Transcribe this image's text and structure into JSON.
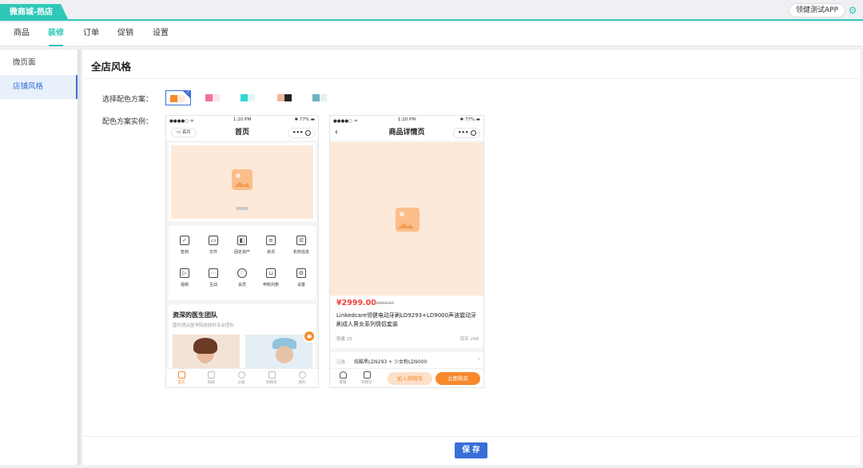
{
  "app": {
    "tab_label": "微商城-热店",
    "app_selector": "领健测试APP",
    "settings_icon": "gear-icon"
  },
  "nav": {
    "items": [
      {
        "label": "商品",
        "active": false
      },
      {
        "label": "装修",
        "active": true
      },
      {
        "label": "订单",
        "active": false
      },
      {
        "label": "促销",
        "active": false
      },
      {
        "label": "设置",
        "active": false
      }
    ]
  },
  "sidebar": {
    "items": [
      {
        "label": "微页面",
        "active": false
      },
      {
        "label": "店铺风格",
        "active": true
      }
    ]
  },
  "main": {
    "title": "全店风格",
    "scheme_label": "选择配色方案：",
    "example_label": "配色方案实例：",
    "save_label": "保 存"
  },
  "schemes": [
    {
      "primary": "#f7892b",
      "secondary": "#fde9d9",
      "selected": true
    },
    {
      "primary": "#f0739b",
      "secondary": "#fde3ec",
      "selected": false
    },
    {
      "primary": "#2fd7cf",
      "secondary": "#dff7f6",
      "selected": false
    },
    {
      "primary": "#f2b79a",
      "secondary": "#222222",
      "selected": false
    },
    {
      "primary": "#6db3c2",
      "secondary": "#e4f1f4",
      "selected": false
    }
  ],
  "phone_common": {
    "signal": "●●●●○ ᯤ",
    "time": "1:20 PM",
    "battery": "✱ 77% ▬"
  },
  "phone_home": {
    "title": "首页",
    "card_btn": "名片",
    "grid": [
      "签到",
      "文件",
      "固定资产",
      "资讯",
      "机构信息",
      "视频",
      "互动",
      "会员",
      "申购列表",
      "设置"
    ],
    "section_title": "资深的医生团队",
    "section_sub": "国内顶尖医学院皮肤科专业团队",
    "tabs": [
      "首页",
      "商城",
      "分类",
      "购物车",
      "我的"
    ]
  },
  "phone_detail": {
    "title": "商品详情页",
    "price": "¥2999.00",
    "original_price": "¥3999.00",
    "product_name": "Linkedcare领健电动牙刷LD9293+LD9000声波震动牙刷成人男女系列情侣套装",
    "sales": "销量 25",
    "stock": "库存 298",
    "selected_label": "已选",
    "selected_value": "炫酷黑LD9293 + 少女粉LD9000",
    "tab_service": "客服",
    "tab_cart": "购物车",
    "add_cart": "加入购物车",
    "buy_now": "立即购买"
  }
}
